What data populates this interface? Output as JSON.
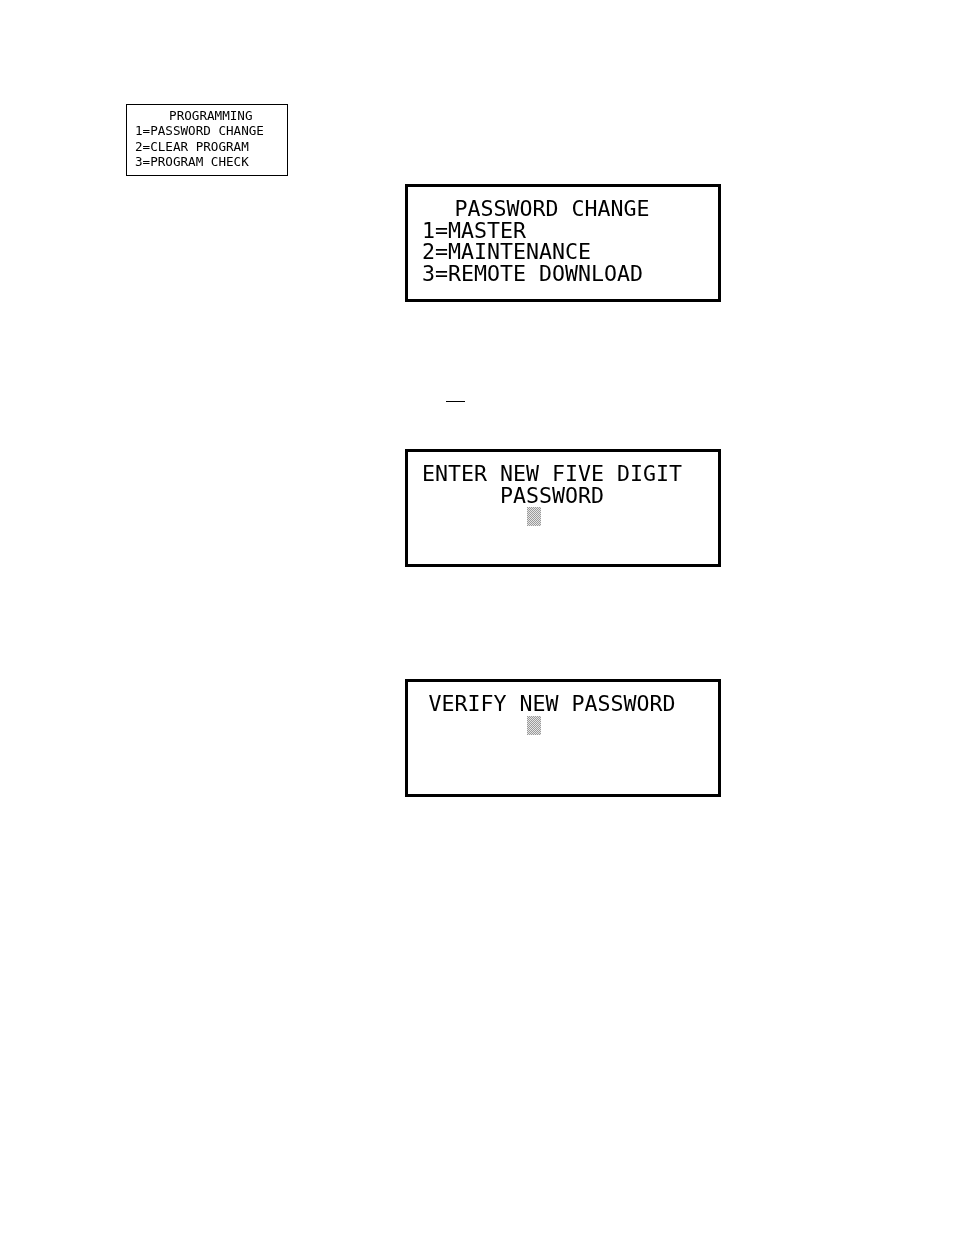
{
  "programming_menu": {
    "lines": [
      {
        "text": "PROGRAMMING",
        "kind": "heading"
      },
      {
        "text": "1=PASSWORD CHANGE",
        "kind": "option"
      },
      {
        "text": "2=CLEAR PROGRAM",
        "kind": "option"
      },
      {
        "text": "3=PROGRAM CHECK",
        "kind": "option"
      }
    ]
  },
  "lcd_screens": [
    {
      "lines": [
        {
          "text": "PASSWORD CHANGE",
          "kind": "heading"
        },
        {
          "text": "1=MASTER",
          "kind": "option"
        },
        {
          "text": "2=MAINTENANCE",
          "kind": "option"
        },
        {
          "text": "3=REMOTE DOWNLOAD",
          "kind": "option"
        }
      ],
      "cursor": false
    },
    {
      "lines": [
        {
          "text": "ENTER NEW FIVE DIGIT",
          "kind": "heading"
        },
        {
          "text": "PASSWORD",
          "kind": "heading"
        }
      ],
      "cursor": true
    },
    {
      "lines": [
        {
          "text": "VERIFY NEW PASSWORD",
          "kind": "heading"
        }
      ],
      "cursor": true
    }
  ]
}
